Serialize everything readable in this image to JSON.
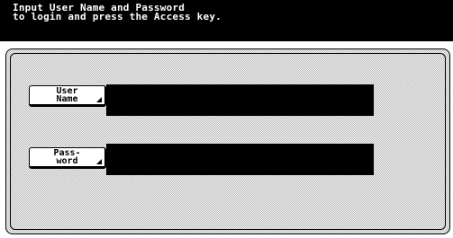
{
  "header": {
    "instruction": "Input User Name and Password\nto login and press the Access key."
  },
  "form": {
    "user_name": {
      "button_label": "User\nName",
      "value": ""
    },
    "password": {
      "button_label": "Pass-\nword",
      "value": ""
    }
  },
  "colors": {
    "header_background": "#000000",
    "header_text": "#ffffff",
    "field_background": "#000000",
    "button_background": "#ffffff"
  }
}
